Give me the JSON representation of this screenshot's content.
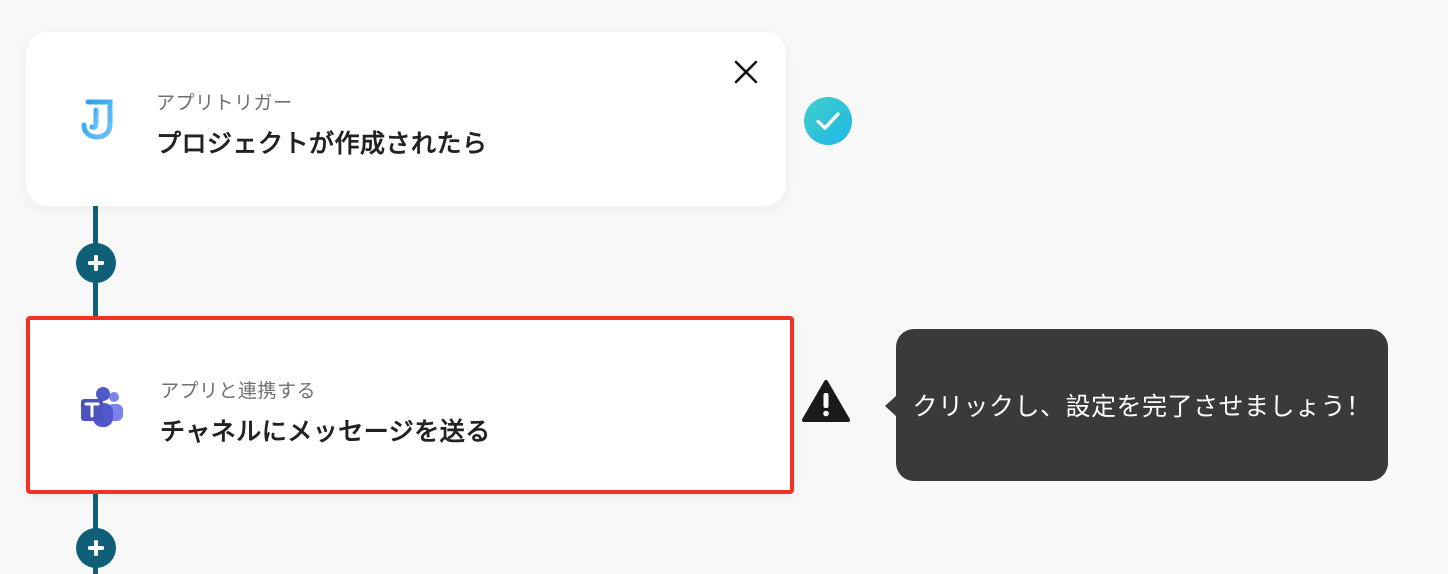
{
  "trigger_step": {
    "subtitle": "アプリトリガー",
    "title": "プロジェクトが作成されたら",
    "app_icon": "jooto-icon",
    "status_icon": "check-circle-icon"
  },
  "action_step": {
    "subtitle": "アプリと連携する",
    "title": "チャネルにメッセージを送る",
    "app_icon": "microsoft-teams-icon",
    "status_icon": "warning-triangle-icon"
  },
  "tooltip": {
    "text": "クリックし、設定を完了させましょう！"
  },
  "colors": {
    "connector": "#0f5f79",
    "highlight_border": "#ee3224",
    "check_gradient_start": "#3fd0c9",
    "check_gradient_end": "#1fb6e8",
    "tooltip_bg": "#3a3a3a"
  }
}
